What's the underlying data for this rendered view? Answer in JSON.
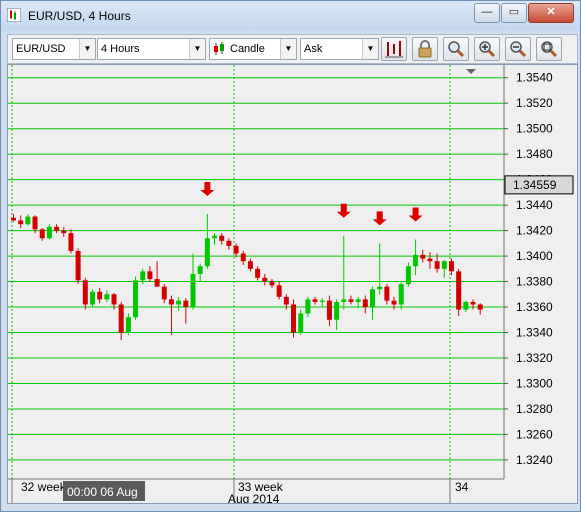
{
  "window": {
    "title": "EUR/USD,  4 Hours",
    "minimize_label": "—",
    "restore_label": "▭",
    "close_label": "✕"
  },
  "toolbar": {
    "instrument": "EUR/USD",
    "period": "4 Hours",
    "chart_type": "Candle",
    "side": "Ask",
    "tools": [
      "bar-chart-icon",
      "lock-icon",
      "zoom-select-icon",
      "zoom-in-icon",
      "zoom-out-icon",
      "zoom-fit-icon"
    ]
  },
  "colors": {
    "up_candle": "#00c800",
    "down_candle": "#d40000",
    "grid": "#00c800",
    "arrow": "#e00000",
    "chart_bg": "#efefef"
  },
  "price_box": "1.34559",
  "cursor_label": "00:00 06 Aug",
  "time_labels": [
    "32 week",
    "33 week",
    "34"
  ],
  "month_label": "Aug 2014",
  "chart_data": {
    "type": "candlestick",
    "ylim": [
      1.3225,
      1.355
    ],
    "y_ticks": [
      "1.3540",
      "1.3520",
      "1.3500",
      "1.3480",
      "1.3460",
      "1.3440",
      "1.3420",
      "1.3400",
      "1.3380",
      "1.3360",
      "1.3340",
      "1.3320",
      "1.3300",
      "1.3280",
      "1.3260",
      "1.3240"
    ],
    "current_price": 1.34559,
    "candles": [
      [
        1.343,
        1.3433,
        1.3427,
        1.3428
      ],
      [
        1.3428,
        1.3432,
        1.3422,
        1.3425
      ],
      [
        1.3425,
        1.3433,
        1.3424,
        1.3431
      ],
      [
        1.3431,
        1.3432,
        1.3418,
        1.3421
      ],
      [
        1.3421,
        1.3422,
        1.3412,
        1.3414
      ],
      [
        1.3414,
        1.3425,
        1.3413,
        1.3423
      ],
      [
        1.3423,
        1.3425,
        1.3418,
        1.342
      ],
      [
        1.342,
        1.3423,
        1.3415,
        1.3418
      ],
      [
        1.3418,
        1.3421,
        1.3402,
        1.3404
      ],
      [
        1.3404,
        1.3406,
        1.3378,
        1.3381
      ],
      [
        1.3381,
        1.3383,
        1.3358,
        1.3362
      ],
      [
        1.3362,
        1.3374,
        1.336,
        1.3372
      ],
      [
        1.3372,
        1.3375,
        1.3363,
        1.3366
      ],
      [
        1.3366,
        1.3373,
        1.3364,
        1.337
      ],
      [
        1.337,
        1.3371,
        1.3358,
        1.3362
      ],
      [
        1.3362,
        1.3364,
        1.3334,
        1.334
      ],
      [
        1.334,
        1.3355,
        1.3338,
        1.3352
      ],
      [
        1.3352,
        1.3384,
        1.335,
        1.3381
      ],
      [
        1.3381,
        1.339,
        1.3378,
        1.3388
      ],
      [
        1.3388,
        1.3392,
        1.338,
        1.3382
      ],
      [
        1.3382,
        1.3396,
        1.3376,
        1.3376
      ],
      [
        1.3376,
        1.3378,
        1.3363,
        1.3366
      ],
      [
        1.3366,
        1.3369,
        1.3338,
        1.3362
      ],
      [
        1.3362,
        1.3368,
        1.3357,
        1.3365
      ],
      [
        1.3365,
        1.3367,
        1.3347,
        1.336
      ],
      [
        1.336,
        1.3402,
        1.3358,
        1.3386
      ],
      [
        1.3386,
        1.3394,
        1.338,
        1.3392
      ],
      [
        1.3392,
        1.3433,
        1.339,
        1.3414
      ],
      [
        1.3414,
        1.3418,
        1.3409,
        1.3416
      ],
      [
        1.3416,
        1.3418,
        1.3409,
        1.3412
      ],
      [
        1.3412,
        1.3414,
        1.3405,
        1.3408
      ],
      [
        1.3408,
        1.341,
        1.3399,
        1.3402
      ],
      [
        1.3402,
        1.3404,
        1.3393,
        1.3396
      ],
      [
        1.3396,
        1.3398,
        1.3388,
        1.339
      ],
      [
        1.339,
        1.3392,
        1.3381,
        1.3383
      ],
      [
        1.3383,
        1.3386,
        1.3377,
        1.338
      ],
      [
        1.338,
        1.3382,
        1.3375,
        1.3377
      ],
      [
        1.3377,
        1.338,
        1.3366,
        1.3368
      ],
      [
        1.3368,
        1.337,
        1.3358,
        1.3362
      ],
      [
        1.3362,
        1.3366,
        1.3336,
        1.334
      ],
      [
        1.334,
        1.3358,
        1.3338,
        1.3355
      ],
      [
        1.3355,
        1.3368,
        1.3352,
        1.3366
      ],
      [
        1.3366,
        1.3368,
        1.3362,
        1.3364
      ],
      [
        1.3364,
        1.3367,
        1.336,
        1.3365
      ],
      [
        1.3365,
        1.3369,
        1.3345,
        1.335
      ],
      [
        1.335,
        1.3366,
        1.3342,
        1.3364
      ],
      [
        1.3364,
        1.3416,
        1.3358,
        1.3366
      ],
      [
        1.3366,
        1.3369,
        1.3362,
        1.3364
      ],
      [
        1.3364,
        1.3368,
        1.3359,
        1.3366
      ],
      [
        1.3366,
        1.3369,
        1.3355,
        1.336
      ],
      [
        1.336,
        1.3376,
        1.335,
        1.3374
      ],
      [
        1.3374,
        1.341,
        1.337,
        1.3376
      ],
      [
        1.3376,
        1.3378,
        1.3362,
        1.3365
      ],
      [
        1.3365,
        1.3368,
        1.3358,
        1.3362
      ],
      [
        1.3362,
        1.338,
        1.3358,
        1.3378
      ],
      [
        1.3378,
        1.3395,
        1.3376,
        1.3392
      ],
      [
        1.3392,
        1.3413,
        1.3385,
        1.3401
      ],
      [
        1.3401,
        1.3405,
        1.3395,
        1.3398
      ],
      [
        1.3398,
        1.3403,
        1.339,
        1.3396
      ],
      [
        1.3396,
        1.3402,
        1.3387,
        1.339
      ],
      [
        1.339,
        1.3397,
        1.3383,
        1.3396
      ],
      [
        1.3396,
        1.3398,
        1.3385,
        1.3388
      ],
      [
        1.3388,
        1.339,
        1.3353,
        1.3358
      ],
      [
        1.3358,
        1.3365,
        1.3356,
        1.3364
      ],
      [
        1.3364,
        1.3366,
        1.3358,
        1.3362
      ],
      [
        1.3362,
        1.3363,
        1.3354,
        1.3358
      ]
    ],
    "down_arrows_at": [
      27,
      46,
      51,
      56
    ]
  }
}
